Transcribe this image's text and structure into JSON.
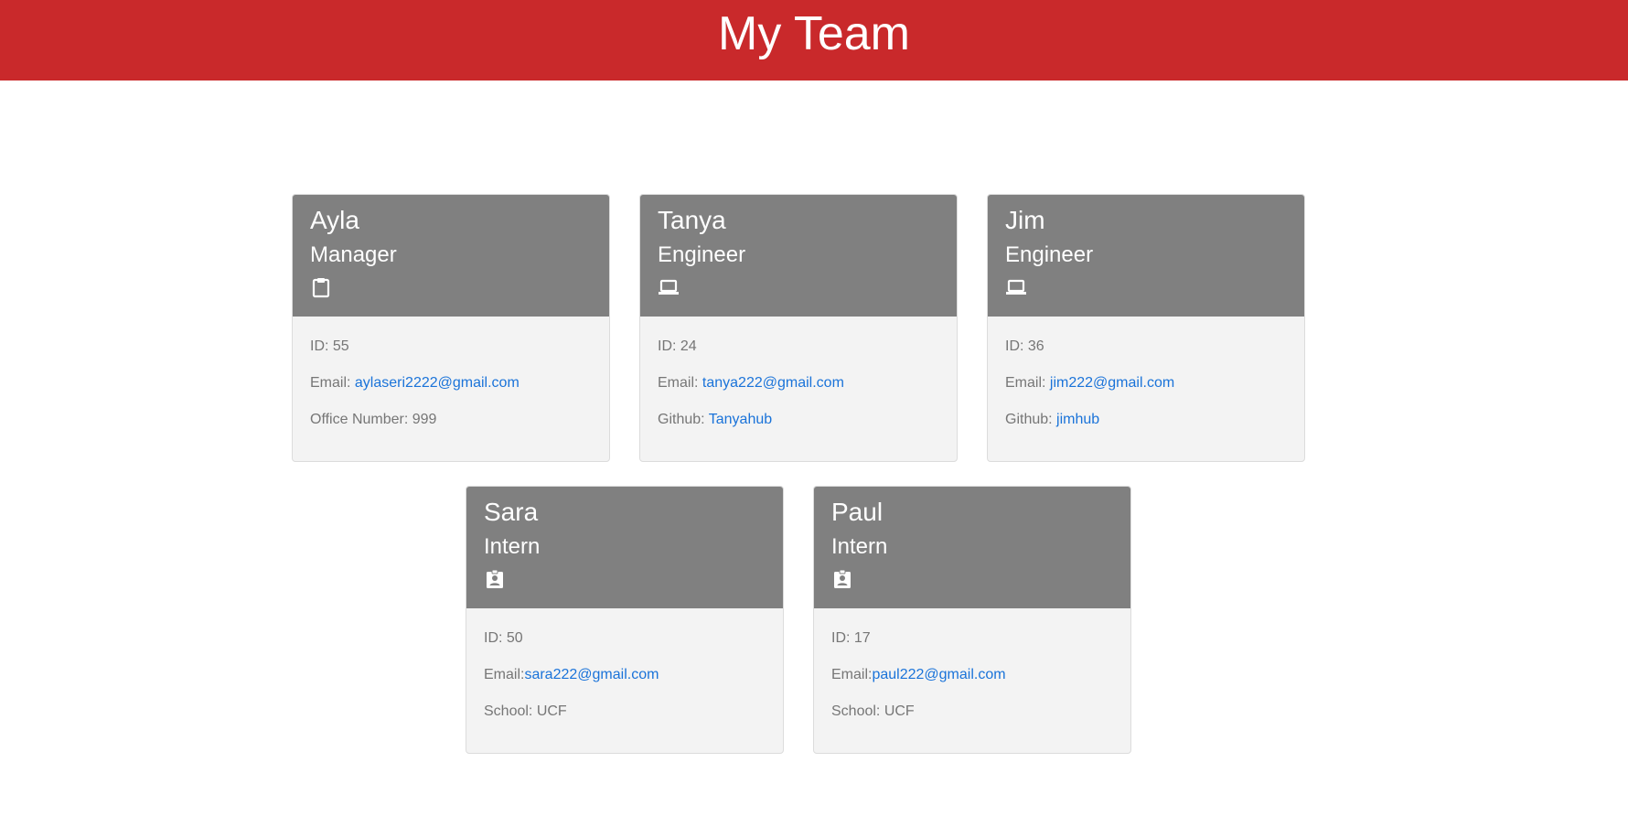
{
  "header": {
    "title": "My Team"
  },
  "colors": {
    "header_bg": "#c9292b",
    "card_header_bg": "#808080",
    "card_body_bg": "#f3f3f3",
    "link": "#1a73d9",
    "text_muted": "#767676"
  },
  "employees": [
    {
      "name": "Ayla",
      "role": "Manager",
      "icon": "clipboard-icon",
      "id_label": "ID: ",
      "id": "55",
      "email_label": "Email: ",
      "email": "aylaseri2222@gmail.com",
      "extra_label": "Office Number: ",
      "extra_value": "999"
    },
    {
      "name": "Tanya",
      "role": "Engineer",
      "icon": "laptop-icon",
      "id_label": "ID: ",
      "id": "24",
      "email_label": "Email: ",
      "email": "tanya222@gmail.com",
      "extra_label": "Github: ",
      "extra_value": "Tanyahub"
    },
    {
      "name": "Jim",
      "role": "Engineer",
      "icon": "laptop-icon",
      "id_label": "ID: ",
      "id": "36",
      "email_label": "Email: ",
      "email": "jim222@gmail.com",
      "extra_label": "Github: ",
      "extra_value": "jimhub"
    },
    {
      "name": "Sara",
      "role": "Intern",
      "icon": "id-badge-icon",
      "id_label": "ID: ",
      "id": "50",
      "email_label": "Email:",
      "email": "sara222@gmail.com",
      "extra_label": "School: ",
      "extra_value": "UCF"
    },
    {
      "name": "Paul",
      "role": "Intern",
      "icon": "id-badge-icon",
      "id_label": "ID: ",
      "id": "17",
      "email_label": "Email:",
      "email": "paul222@gmail.com",
      "extra_label": "School: ",
      "extra_value": "UCF"
    }
  ]
}
